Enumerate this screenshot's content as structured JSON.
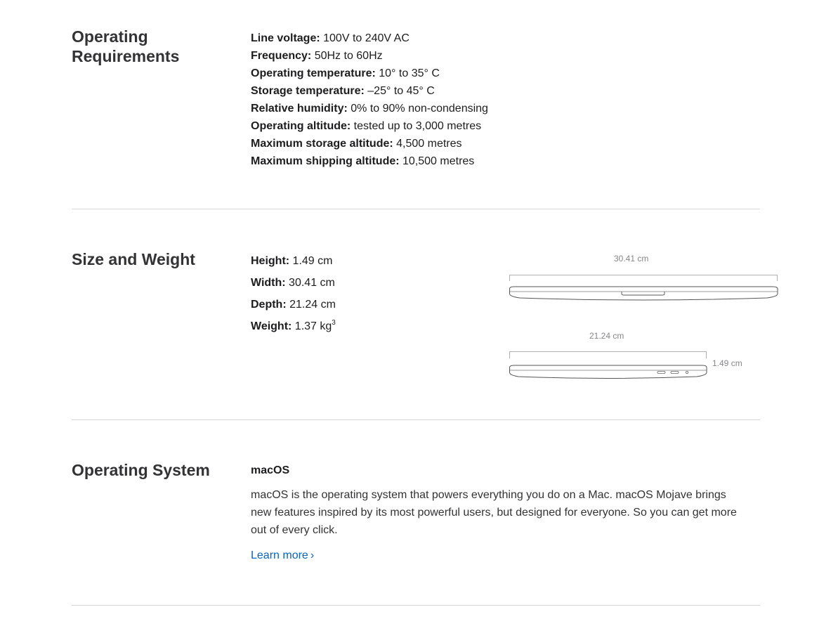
{
  "operating_requirements": {
    "title": "Operating Requirements",
    "specs": [
      {
        "label": "Line voltage:",
        "value": " 100V to 240V AC"
      },
      {
        "label": "Frequency:",
        "value": " 50Hz to 60Hz"
      },
      {
        "label": "Operating temperature:",
        "value": " 10° to 35° C"
      },
      {
        "label": "Storage temperature:",
        "value": " –25° to 45° C"
      },
      {
        "label": "Relative humidity:",
        "value": " 0% to 90% non-condensing"
      },
      {
        "label": "Operating altitude:",
        "value": " tested up to 3,000 metres"
      },
      {
        "label": "Maximum storage altitude:",
        "value": " 4,500 metres"
      },
      {
        "label": "Maximum shipping altitude:",
        "value": " 10,500 metres"
      }
    ]
  },
  "size_and_weight": {
    "title": "Size and Weight",
    "specs": [
      {
        "label": "Height:",
        "value": " 1.49 cm"
      },
      {
        "label": "Width:",
        "value": " 30.41 cm"
      },
      {
        "label": "Depth:",
        "value": " 21.24 cm"
      },
      {
        "label": "Weight:",
        "value": " 1.37 kg",
        "footnote": "3"
      }
    ],
    "diagram": {
      "front_width_label": "30.41 cm",
      "side_depth_label": "21.24 cm",
      "side_height_label": "1.49 cm"
    }
  },
  "operating_system": {
    "title": "Operating System",
    "subtitle": "macOS",
    "description": "macOS is the operating system that powers everything you do on a Mac. macOS Mojave brings new features inspired by its most powerful users, but designed for everyone. So you can get more out of every click.",
    "link_label": "Learn more",
    "link_chevron": "›"
  },
  "colors": {
    "text": "#1d1d1f",
    "heading": "#333336",
    "link": "#0066cc",
    "divider": "#d6d6d6",
    "diagram_label": "#86868b"
  }
}
